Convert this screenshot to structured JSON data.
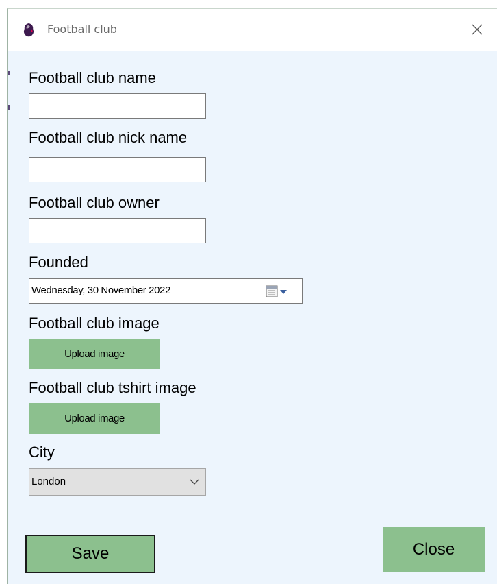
{
  "window": {
    "title": "Football club",
    "icon": "premier-league-lion-icon",
    "close_icon": "close-icon"
  },
  "form": {
    "name_label": "Football club name",
    "name_value": "",
    "nickname_label": "Football club nick name",
    "nickname_value": "",
    "owner_label": "Football club owner",
    "owner_value": "",
    "founded_label": "Founded",
    "founded_value": "Wednesday, 30 November 2022",
    "image_label": "Football club image",
    "image_button": "Upload image",
    "tshirt_label": "Football club tshirt image",
    "tshirt_button": "Upload image",
    "city_label": "City",
    "city_value": "London"
  },
  "actions": {
    "save_label": "Save",
    "close_label": "Close"
  },
  "colors": {
    "form_background": "#edf5fd",
    "button_green": "#8cc08e",
    "titlebar": "#ffffff"
  }
}
